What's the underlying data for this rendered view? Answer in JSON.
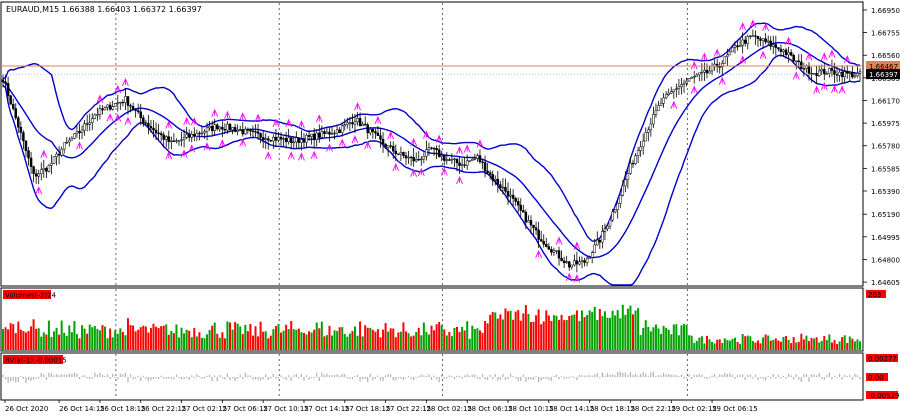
{
  "window": {
    "title": "EURAUD,M15  1.66388 1.66403 1.66372 1.66397"
  },
  "colors": {
    "background": "#ffffff",
    "frame": "#000000",
    "grid": "#000000",
    "candle": "#000000",
    "bands": "#0000cc",
    "fractal": "#ff00ff",
    "level_line": "#e67e50",
    "volume_up": "#00a000",
    "volume_down": "#ff0000",
    "price_badge_bg": "#000000",
    "level_badge_bg": "#e67e50",
    "red_label": "#ff0000"
  },
  "chart_data": [
    {
      "type": "candlestick",
      "symbol": "EURAUD",
      "timeframe": "M15",
      "ohlc": {
        "open": 1.66388,
        "high": 1.66403,
        "low": 1.66372,
        "close": 1.66397
      },
      "y_axis_ticks": [
        "1.66950",
        "1.66755",
        "1.66560",
        "1.66365",
        "1.66170",
        "1.65975",
        "1.65780",
        "1.65585",
        "1.65390",
        "1.65190",
        "1.64995",
        "1.64800",
        "1.64605"
      ],
      "ylim": [
        1.6458,
        1.6701
      ],
      "level_line": {
        "value": 1.66467,
        "label": "1.66467"
      },
      "price_line": {
        "value": 1.66397,
        "label": "1.66397"
      },
      "close_path": [
        [
          0,
          1.6636
        ],
        [
          6,
          1.6595
        ],
        [
          12,
          1.6552
        ],
        [
          18,
          1.656
        ],
        [
          24,
          1.6578
        ],
        [
          30,
          1.659
        ],
        [
          36,
          1.6605
        ],
        [
          42,
          1.6612
        ],
        [
          48,
          1.6618
        ],
        [
          54,
          1.6602
        ],
        [
          60,
          1.659
        ],
        [
          66,
          1.658
        ],
        [
          72,
          1.6585
        ],
        [
          78,
          1.659
        ],
        [
          84,
          1.6595
        ],
        [
          90,
          1.6593
        ],
        [
          96,
          1.6589
        ],
        [
          102,
          1.6586
        ],
        [
          108,
          1.6584
        ],
        [
          114,
          1.6582
        ],
        [
          120,
          1.6585
        ],
        [
          126,
          1.6588
        ],
        [
          132,
          1.6592
        ],
        [
          138,
          1.6601
        ],
        [
          144,
          1.659
        ],
        [
          150,
          1.6578
        ],
        [
          156,
          1.657
        ],
        [
          162,
          1.6565
        ],
        [
          168,
          1.6575
        ],
        [
          174,
          1.6566
        ],
        [
          180,
          1.6562
        ],
        [
          186,
          1.6568
        ],
        [
          192,
          1.655
        ],
        [
          198,
          1.6537
        ],
        [
          204,
          1.6518
        ],
        [
          210,
          1.65
        ],
        [
          216,
          1.6487
        ],
        [
          222,
          1.6475
        ],
        [
          228,
          1.6478
        ],
        [
          234,
          1.6497
        ],
        [
          240,
          1.6525
        ],
        [
          246,
          1.656
        ],
        [
          252,
          1.659
        ],
        [
          258,
          1.6615
        ],
        [
          264,
          1.6628
        ],
        [
          270,
          1.6636
        ],
        [
          276,
          1.6641
        ],
        [
          282,
          1.665
        ],
        [
          288,
          1.6665
        ],
        [
          294,
          1.6672
        ],
        [
          300,
          1.6666
        ],
        [
          306,
          1.666
        ],
        [
          312,
          1.6648
        ],
        [
          318,
          1.6641
        ],
        [
          324,
          1.6642
        ],
        [
          330,
          1.664
        ],
        [
          336,
          1.6639
        ]
      ],
      "candle_count": 337
    },
    {
      "type": "bar",
      "label": "Volumes(-2)24",
      "axis_top_label": "203",
      "scale_max": 203,
      "bar_count": 337
    },
    {
      "type": "bar",
      "label": "RVIa(-1) -0.00015",
      "axis_labels": [
        "0.00277",
        "0.00",
        "-0.00529"
      ],
      "bar_count": 337
    }
  ],
  "x_axis": {
    "labels": [
      {
        "text": "26 Oct 2020",
        "pos": 0
      },
      {
        "text": "26 Oct 14:15",
        "pos": 22
      },
      {
        "text": "26 Oct 18:15",
        "pos": 38
      },
      {
        "text": "26 Oct 22:15",
        "pos": 54
      },
      {
        "text": "27 Oct 02:15",
        "pos": 70
      },
      {
        "text": "27 Oct 06:15",
        "pos": 86
      },
      {
        "text": "27 Oct 10:15",
        "pos": 102
      },
      {
        "text": "27 Oct 14:15",
        "pos": 118
      },
      {
        "text": "27 Oct 18:15",
        "pos": 134
      },
      {
        "text": "27 Oct 22:15",
        "pos": 150
      },
      {
        "text": "28 Oct 02:15",
        "pos": 166
      },
      {
        "text": "28 Oct 06:15",
        "pos": 182
      },
      {
        "text": "28 Oct 10:15",
        "pos": 198
      },
      {
        "text": "28 Oct 14:15",
        "pos": 214
      },
      {
        "text": "28 Oct 18:15",
        "pos": 230
      },
      {
        "text": "28 Oct 22:15",
        "pos": 246
      },
      {
        "text": "29 Oct 02:15",
        "pos": 262
      },
      {
        "text": "29 Oct 06:15",
        "pos": 278
      }
    ]
  }
}
